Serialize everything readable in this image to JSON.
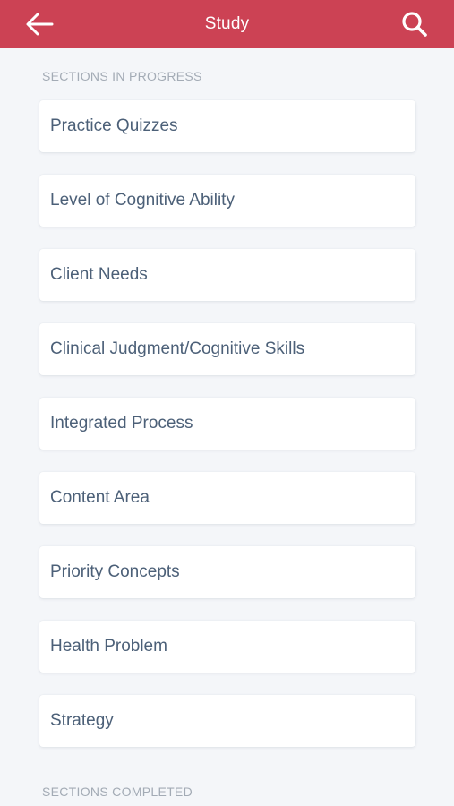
{
  "header": {
    "title": "Study",
    "back_icon": "arrow-left-icon",
    "search_icon": "search-icon",
    "background_color": "#cc4254"
  },
  "sections_in_progress": {
    "heading": "SECTIONS IN PROGRESS",
    "items": [
      {
        "label": "Practice Quizzes"
      },
      {
        "label": "Level of Cognitive Ability"
      },
      {
        "label": "Client Needs"
      },
      {
        "label": "Clinical Judgment/Cognitive Skills"
      },
      {
        "label": "Integrated Process"
      },
      {
        "label": "Content Area"
      },
      {
        "label": "Priority Concepts"
      },
      {
        "label": "Health Problem"
      },
      {
        "label": "Strategy"
      }
    ]
  },
  "sections_completed": {
    "heading": "SECTIONS COMPLETED"
  }
}
